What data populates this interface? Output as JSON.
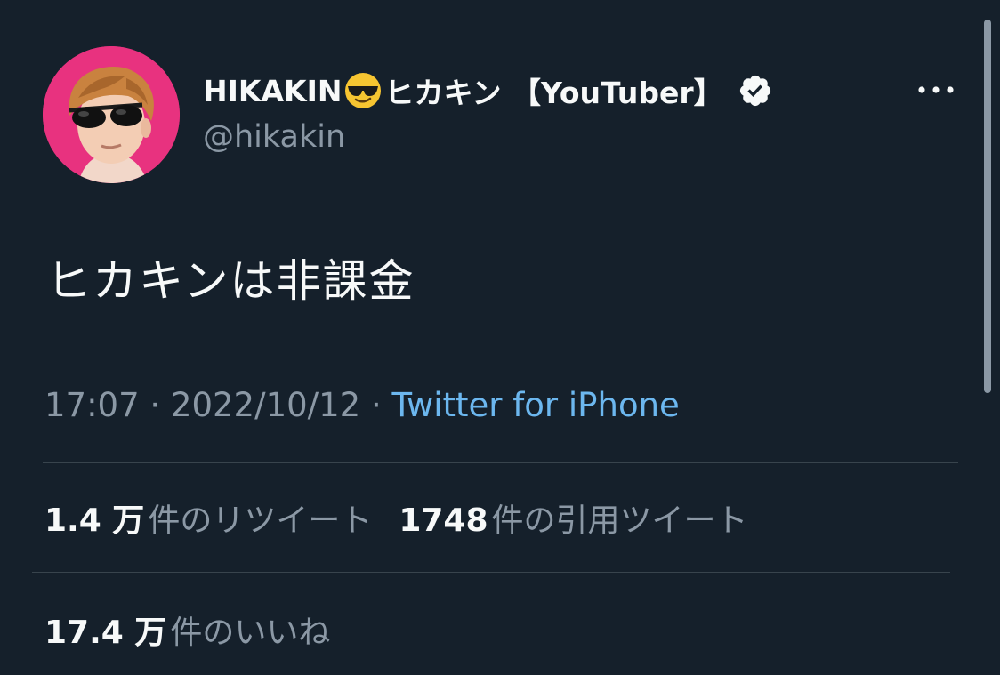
{
  "tweet": {
    "author": {
      "display_name_prefix": "HIKAKIN",
      "display_name_emoji": "sunglasses-face",
      "display_name_suffix": "ヒカキン 【YouTuber】",
      "handle": "@hikakin",
      "verified": true,
      "avatar_bg_color": "#e8327f"
    },
    "text": "ヒカキンは非課金",
    "time": "17:07",
    "date": "2022/10/12",
    "separator": "·",
    "source": "Twitter for iPhone",
    "stats": {
      "retweets": {
        "count": "1.4 万",
        "label": "件のリツイート"
      },
      "quotes": {
        "count": "1748",
        "label": "件の引用ツイート"
      },
      "likes": {
        "count": "17.4 万",
        "label": "件のいいね"
      }
    }
  },
  "icons": {
    "more": "more-horizontal-icon",
    "verified": "verified-badge-icon"
  },
  "colors": {
    "background": "#15202b",
    "primary_text": "#f7f9f9",
    "secondary_text": "#8b98a5",
    "link": "#6cb7ef",
    "divider": "#38444d"
  }
}
